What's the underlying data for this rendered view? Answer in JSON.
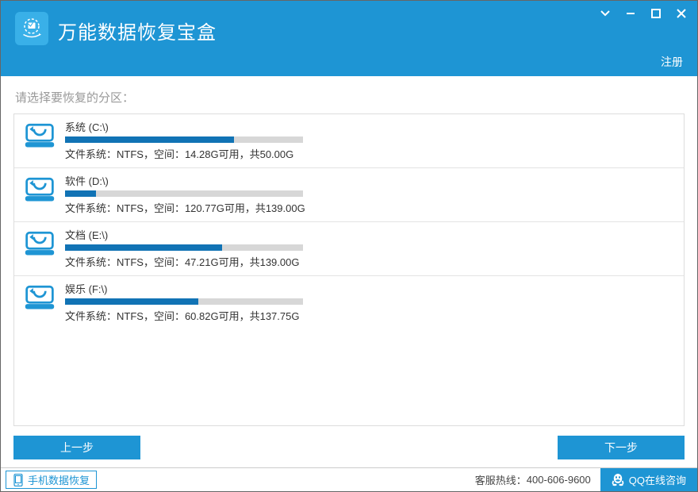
{
  "header": {
    "title": "万能数据恢复宝盒",
    "register": "注册"
  },
  "prompt": "请选择要恢复的分区：",
  "partitions": [
    {
      "name": "系统 (C:\\)",
      "fs": "NTFS",
      "free": "14.28G",
      "total": "50.00G",
      "usedPct": 71
    },
    {
      "name": "软件 (D:\\)",
      "fs": "NTFS",
      "free": "120.77G",
      "total": "139.00G",
      "usedPct": 13
    },
    {
      "name": "文档 (E:\\)",
      "fs": "NTFS",
      "free": "47.21G",
      "total": "139.00G",
      "usedPct": 66
    },
    {
      "name": "娱乐 (F:\\)",
      "fs": "NTFS",
      "free": "60.82G",
      "total": "137.75G",
      "usedPct": 56
    }
  ],
  "labels": {
    "info_prefix": "文件系统：",
    "space_prefix": "，空间：",
    "free_suffix": "可用，共"
  },
  "buttons": {
    "prev": "上一步",
    "next": "下一步"
  },
  "footer": {
    "phone_recovery": "手机数据恢复",
    "hotline_label": "客服热线：",
    "hotline_number": "400-606-9600",
    "qq": "QQ在线咨询"
  }
}
